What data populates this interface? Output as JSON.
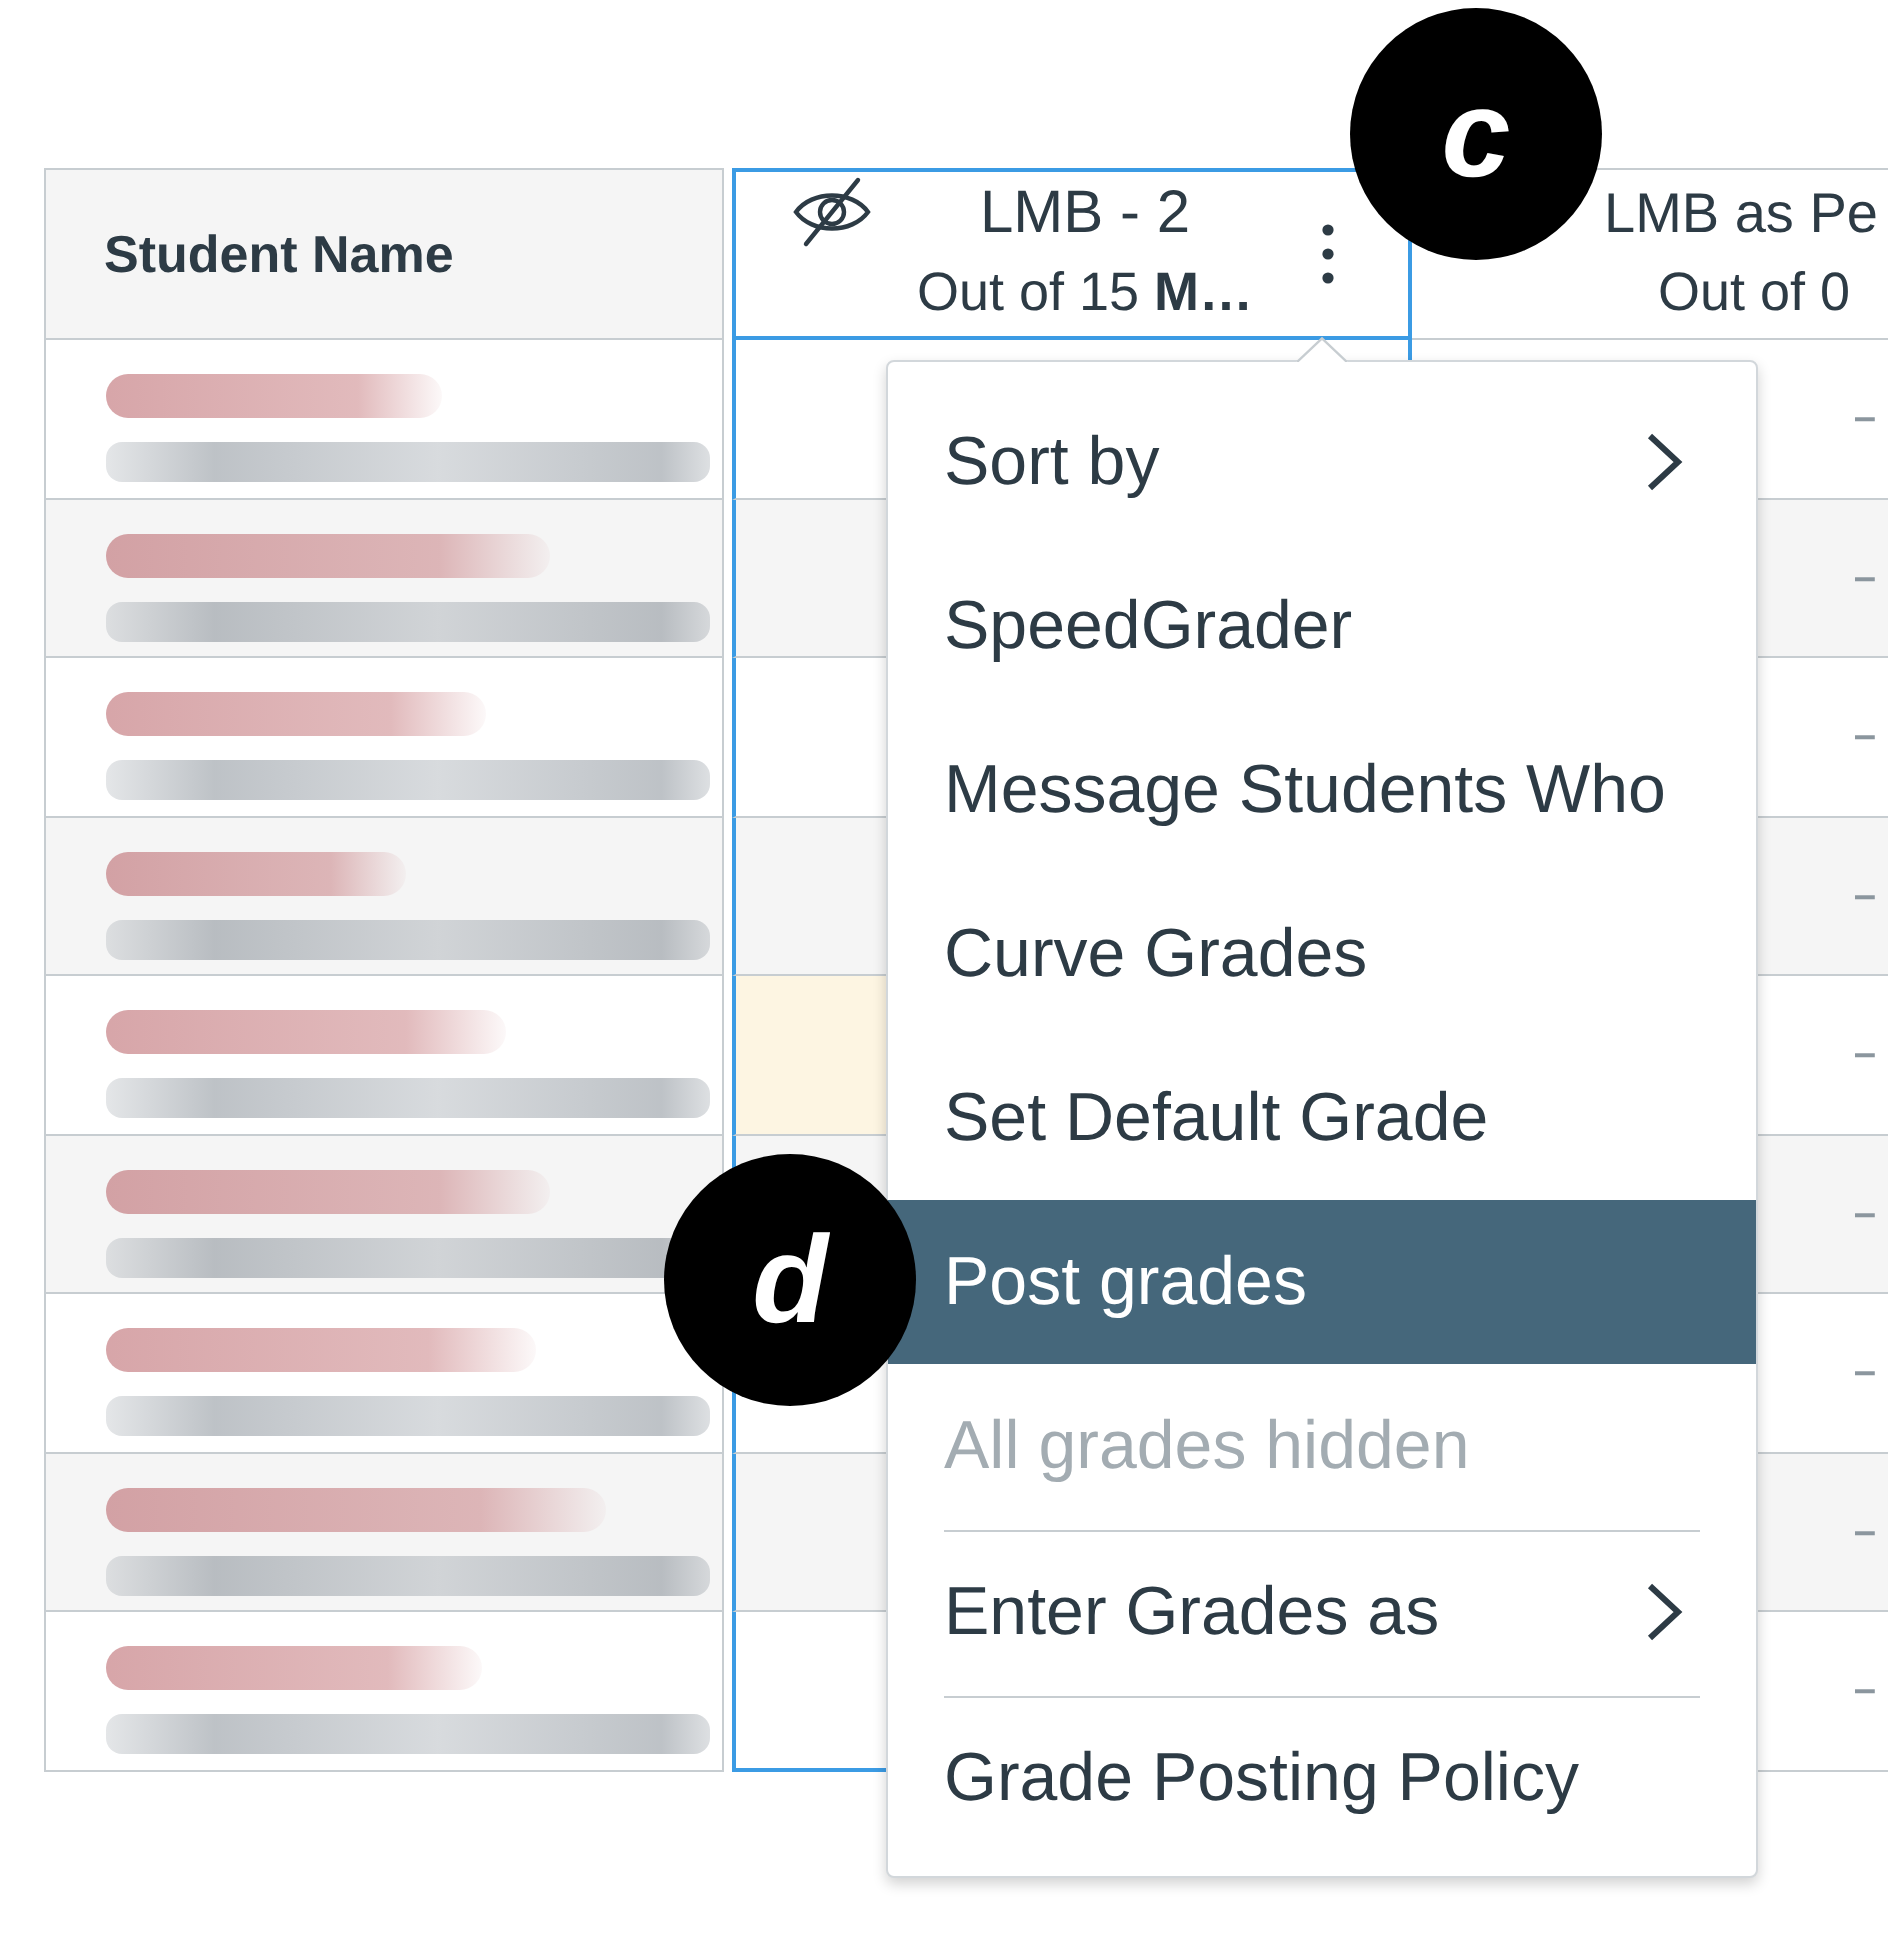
{
  "gradebook": {
    "name_column": {
      "title": "Student Name"
    },
    "columns": [
      {
        "title": "LMB - 2",
        "subtitle": "Out of 15 **M…**",
        "selected": true,
        "grades_hidden": true
      },
      {
        "title": "LMB as Pe",
        "subtitle": "Out of 0",
        "selected": false,
        "grades_hidden": false
      }
    ],
    "rows": [
      {
        "highlighted": false,
        "cell_3": "–"
      },
      {
        "highlighted": false,
        "cell_3": "–"
      },
      {
        "highlighted": false,
        "cell_3": "–"
      },
      {
        "highlighted": false,
        "cell_3": "–"
      },
      {
        "highlighted": true,
        "cell_3": "–"
      },
      {
        "highlighted": false,
        "cell_3": "–"
      },
      {
        "highlighted": false,
        "cell_3": "–"
      },
      {
        "highlighted": false,
        "cell_3": "–"
      },
      {
        "highlighted": false,
        "cell_3": "–"
      }
    ]
  },
  "menu": {
    "items": [
      {
        "label": "Sort by",
        "kind": "submenu",
        "selected": false,
        "disabled": false,
        "divider_above": false
      },
      {
        "label": "SpeedGrader",
        "kind": "action",
        "selected": false,
        "disabled": false,
        "divider_above": false
      },
      {
        "label": "Message Students Who",
        "kind": "action",
        "selected": false,
        "disabled": false,
        "divider_above": false
      },
      {
        "label": "Curve Grades",
        "kind": "action",
        "selected": false,
        "disabled": false,
        "divider_above": false
      },
      {
        "label": "Set Default Grade",
        "kind": "action",
        "selected": false,
        "disabled": false,
        "divider_above": false
      },
      {
        "label": "Post grades",
        "kind": "action",
        "selected": true,
        "disabled": false,
        "divider_above": false
      },
      {
        "label": "All grades hidden",
        "kind": "action",
        "selected": false,
        "disabled": true,
        "divider_above": false
      },
      {
        "label": "Enter Grades as",
        "kind": "submenu",
        "selected": false,
        "disabled": false,
        "divider_above": true
      },
      {
        "label": "Grade Posting Policy",
        "kind": "action",
        "selected": false,
        "disabled": false,
        "divider_above": true
      }
    ]
  },
  "callouts": [
    {
      "label": "c"
    },
    {
      "label": "d"
    }
  ]
}
